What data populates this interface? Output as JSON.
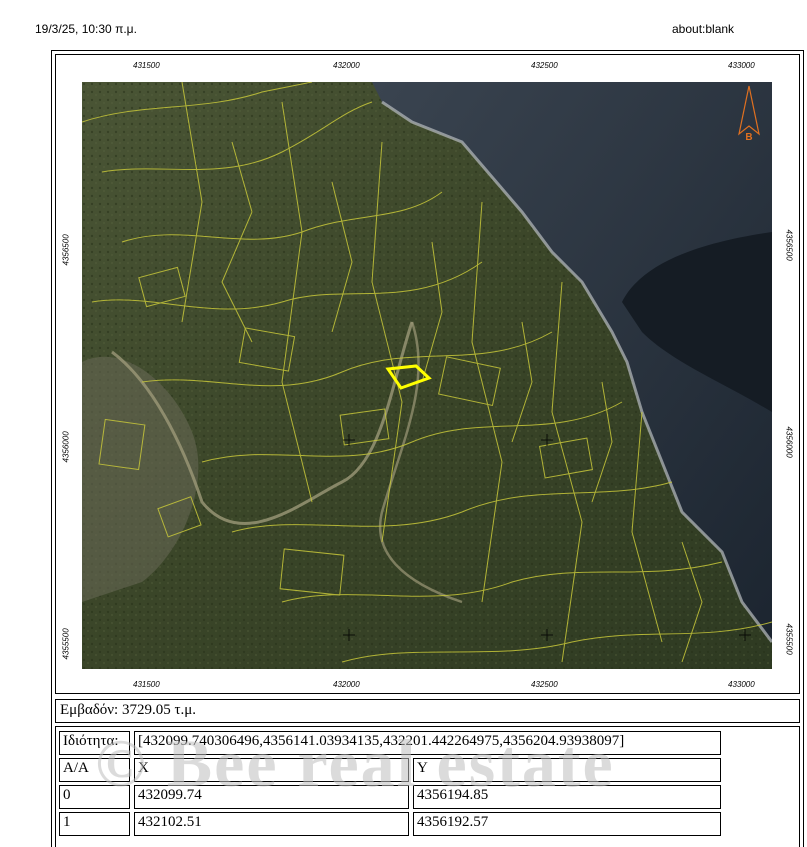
{
  "header": {
    "datetime": "19/3/25, 10:30 π.μ.",
    "url": "about:blank"
  },
  "map": {
    "x_ticks_top": [
      "431500",
      "432000",
      "432500",
      "433000"
    ],
    "x_ticks_bottom": [
      "431500",
      "432000",
      "432500",
      "433000"
    ],
    "y_ticks_left": [
      "4356500",
      "4356000",
      "4355500"
    ],
    "y_ticks_right": [
      "4356500",
      "4356000",
      "4355500"
    ],
    "north_label": "Β",
    "colors": {
      "parcel_lines": "#c8c83a",
      "highlight": "#ffff00",
      "sea": "#2a3440",
      "land": "#3d4a2e",
      "north_arrow": "#e07020"
    }
  },
  "area": {
    "text": "Εμβαδόν: 3729.05 τ.μ."
  },
  "property": {
    "label": "Ιδιότητα:",
    "value": "[432099.740306496,4356141.03934135,432201.442264975,4356204.93938097]"
  },
  "table": {
    "headers": [
      "Α/Α",
      "X",
      "Y"
    ],
    "rows": [
      [
        "0",
        "432099.74",
        "4356194.85"
      ],
      [
        "1",
        "432102.51",
        "4356192.57"
      ]
    ]
  },
  "watermark": "© Bee real estate"
}
